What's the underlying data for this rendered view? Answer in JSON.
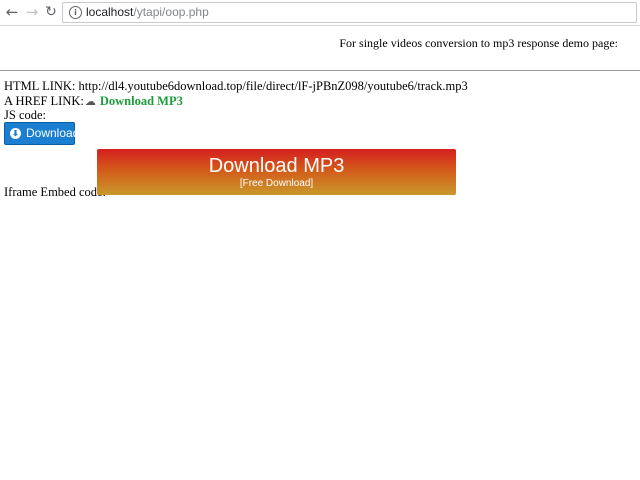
{
  "browser": {
    "url_host": "localhost",
    "url_path": "/ytapi/oop.php",
    "icons": [
      "back-arrow-icon",
      "forward-arrow-icon",
      "reload-icon",
      "info-icon"
    ]
  },
  "page": {
    "header_text": "For single videos conversion to mp3 response demo page:",
    "html_link_label": "HTML LINK:",
    "html_link_url": "http://dl4.youtube6download.top/file/direct/lF-jPBnZ098/youtube6/track.mp3",
    "a_href_label": "A HREF LINK:",
    "a_href_text": "Download MP3",
    "js_label": "JS code:",
    "js_button_label": "Download",
    "iframe_label": "Iframe Embed code:",
    "iframe_button_title": "Download MP3",
    "iframe_button_sub": "[Free Download]"
  },
  "colors": {
    "link_green": "#1e9c3b",
    "js_button_blue": "#1a7fd1",
    "mp3_gradient_top": "#d51f1f",
    "mp3_gradient_bottom": "#c9982a"
  }
}
